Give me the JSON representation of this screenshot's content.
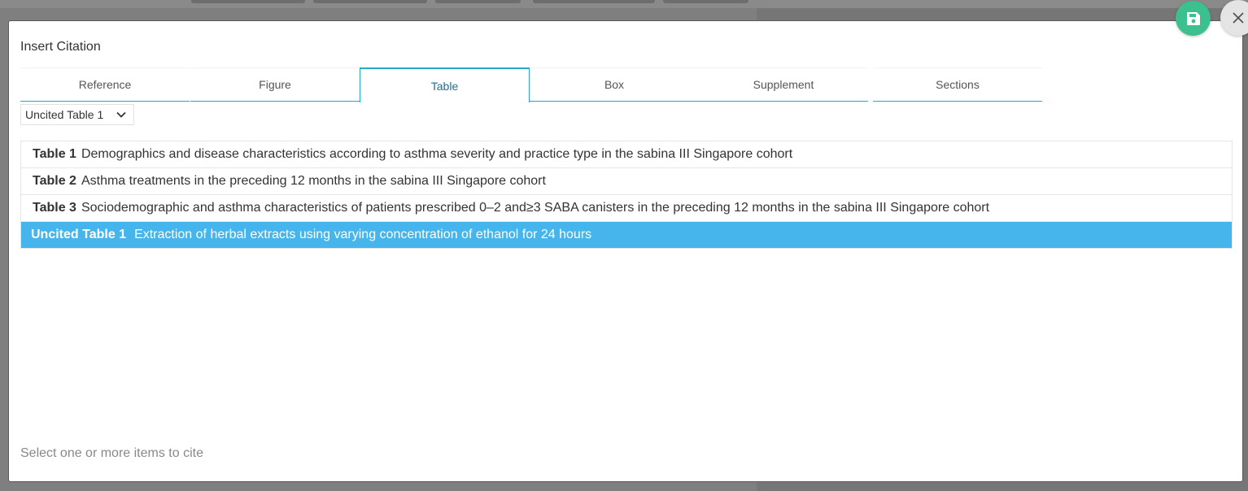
{
  "modal": {
    "title": "Insert Citation",
    "tabs": [
      {
        "label": "Reference",
        "active": false
      },
      {
        "label": "Figure",
        "active": false
      },
      {
        "label": "Table",
        "active": true
      },
      {
        "label": "Box",
        "active": false
      },
      {
        "label": "Supplement",
        "active": false
      },
      {
        "label": "Sections",
        "active": false
      }
    ],
    "filter": {
      "selected": "Uncited Table 1"
    },
    "items": [
      {
        "label": "Table 1",
        "text": "Demographics and disease characteristics according to asthma severity and practice type in the sabina III Singapore cohort",
        "selected": false
      },
      {
        "label": "Table 2",
        "text": "Asthma treatments in the preceding 12 months in the sabina III Singapore cohort",
        "selected": false
      },
      {
        "label": "Table 3",
        "text": "Sociodemographic and asthma characteristics of patients prescribed 0–2 and≥3 SABA canisters in the preceding 12 months in the sabina III Singapore cohort",
        "selected": false
      },
      {
        "label": "Uncited Table 1",
        "text": "Extraction of herbal extracts using varying concentration of ethanol for 24 hours",
        "selected": true
      }
    ],
    "footer_hint": "Select one or more items to cite"
  },
  "actions": {
    "save_icon": "floppy-disk-icon",
    "close_icon": "close-icon"
  },
  "colors": {
    "accent": "#2aa6c9",
    "selected_row": "#45b5ec",
    "save_button": "#3cc08f",
    "close_button": "#e4e4e4"
  }
}
